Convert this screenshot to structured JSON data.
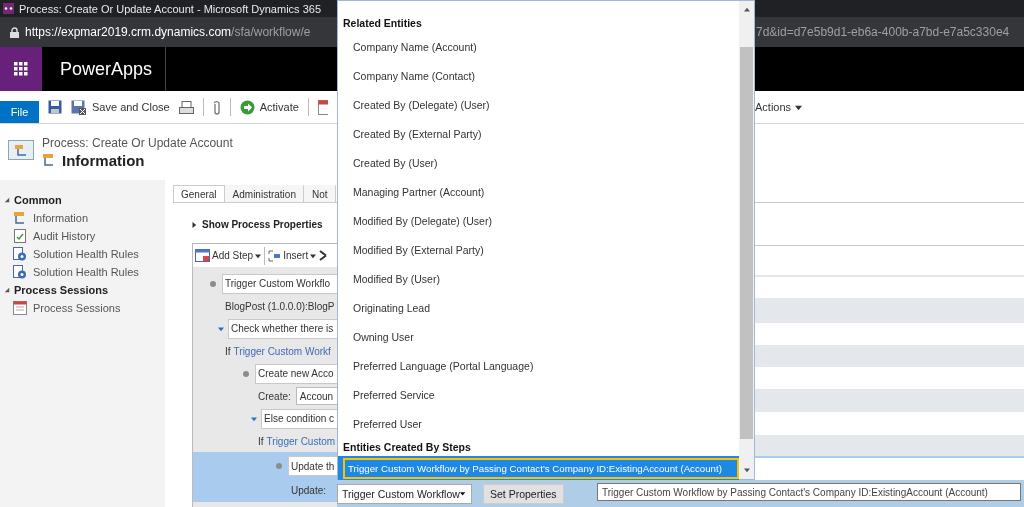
{
  "browser": {
    "title": "Process: Create Or Update Account - Microsoft Dynamics 365",
    "url_host": "https://expmar2019.crm.dynamics.com",
    "url_path": "/sfa/workflow/e",
    "url_tail": "7d&id=d7e5b9d1-eb6a-400b-a7bd-e7a5c330e4"
  },
  "app_bar": {
    "name": "PowerApps"
  },
  "command_bar": {
    "file": "File",
    "commands": [
      {
        "kind": "save"
      },
      {
        "kind": "save_close",
        "label": "Save and Close"
      },
      {
        "kind": "print"
      },
      {
        "kind": "attach"
      },
      {
        "kind": "activate",
        "label": "Activate"
      },
      {
        "kind": "calendar"
      }
    ],
    "actions": "Actions"
  },
  "header": {
    "breadcrumb": "Process: Create Or Update Account",
    "title": "Information"
  },
  "sidebar": {
    "groups": [
      {
        "label": "Common",
        "expanded": true,
        "items": [
          {
            "label": "Information",
            "kind": "process"
          },
          {
            "label": "Audit History",
            "kind": "audit"
          },
          {
            "label": "Solution Health Rules",
            "kind": "health"
          },
          {
            "label": "Solution Health Rules",
            "kind": "health"
          }
        ]
      },
      {
        "label": "Process Sessions",
        "expanded": true,
        "items": [
          {
            "label": "Process Sessions",
            "kind": "sessions"
          }
        ]
      }
    ]
  },
  "tabs": [
    {
      "label": "General",
      "selected": true
    },
    {
      "label": "Administration",
      "selected": false
    },
    {
      "label": "Not",
      "selected": false
    }
  ],
  "properties_toggle": {
    "label": "Show Process Properties",
    "expanded": false
  },
  "designer": {
    "toolbar": [
      {
        "kind": "add",
        "label": "Add Step"
      },
      {
        "kind": "insert",
        "label": "Insert"
      },
      {
        "kind": "delete"
      }
    ],
    "steps": [
      {
        "kind": "action",
        "title": "Trigger Custom Workflo",
        "detail": "BlogPost (1.0.0.0):BlogP",
        "selected": false
      },
      {
        "kind": "check",
        "title": "Check whether there is",
        "expanded": true,
        "condition_prefix": "If",
        "condition_link": "Trigger Custom Workf",
        "selected": false,
        "children": [
          {
            "kind": "record",
            "title": "Create new Acco",
            "field_label": "Create:",
            "field_value": "Accoun",
            "selected": false
          },
          {
            "kind": "check",
            "title": "Else condition c",
            "expanded": true,
            "condition_prefix": "If",
            "condition_link": "Trigger Custom",
            "selected": false,
            "children": [
              {
                "kind": "record",
                "title": "Update th",
                "field_label": "Update:",
                "selected": true
              }
            ]
          }
        ]
      }
    ]
  },
  "dropdown": {
    "groups": [
      {
        "heading": "Related Entities",
        "items": [
          {
            "label": "Company Name (Account)",
            "selected": false
          },
          {
            "label": "Company Name (Contact)",
            "selected": false
          },
          {
            "label": "Created By (Delegate) (User)",
            "selected": false
          },
          {
            "label": "Created By (External Party)",
            "selected": false
          },
          {
            "label": "Created By (User)",
            "selected": false
          },
          {
            "label": "Managing Partner (Account)",
            "selected": false
          },
          {
            "label": "Modified By (Delegate) (User)",
            "selected": false
          },
          {
            "label": "Modified By (External Party)",
            "selected": false
          },
          {
            "label": "Modified By (User)",
            "selected": false
          },
          {
            "label": "Originating Lead",
            "selected": false
          },
          {
            "label": "Owning User",
            "selected": false
          },
          {
            "label": "Preferred Language (Portal Language)",
            "selected": false
          },
          {
            "label": "Preferred Service",
            "selected": false
          },
          {
            "label": "Preferred User",
            "selected": false
          }
        ]
      },
      {
        "heading": "Entities Created By Steps",
        "items": [
          {
            "label": "Trigger Custom Workflow by Passing Contact's Company ID:ExistingAccount (Account)",
            "selected": true
          }
        ]
      }
    ]
  },
  "update_controls": {
    "select": "Trigger Custom Workflow",
    "button": "Set Properties"
  },
  "tooltip": "Trigger Custom Workflow by Passing Contact's Company ID:ExistingAccount (Account)"
}
